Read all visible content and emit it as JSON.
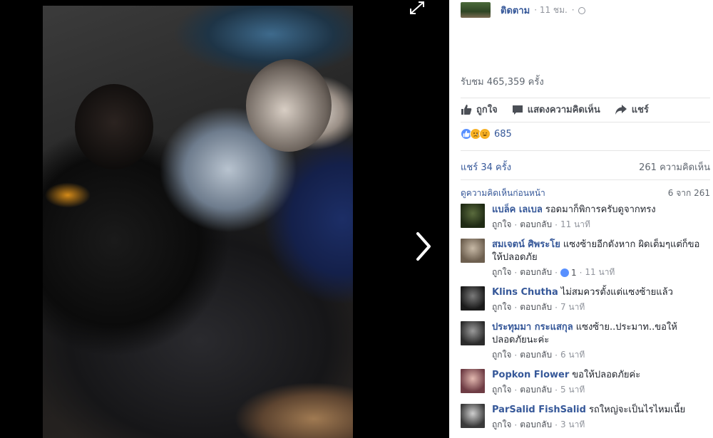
{
  "post": {
    "follow_label": "ติดตาม",
    "time": "11 ชม.",
    "views": "รับชม 465,359 ครั้ง",
    "actions": {
      "like": "ถูกใจ",
      "comment": "แสดงความคิดเห็น",
      "share": "แชร์"
    },
    "reaction_count": "685",
    "shares": "แชร์ 34 ครั้ง",
    "comment_count": "261 ความคิดเห็น",
    "prev_comments": "ดูความคิดเห็นก่อนหน้า",
    "pager": "6 จาก 261"
  },
  "comments": [
    {
      "name": "แบล็ค เลเบล",
      "text": "รอดมาก็พิการครับดูจากทรง",
      "like": "ถูกใจ",
      "reply": "ตอบกลับ",
      "time": "11 นาที",
      "replies": ""
    },
    {
      "name": "สมเจตน์ ศิพระโย",
      "text": "แซงซ้ายอีกดังหาก ผิดเต็มๆแต่ก็ขอให้ปลอดภัย",
      "like": "ถูกใจ",
      "reply": "ตอบกลับ",
      "time": "11 นาที",
      "replies": "1"
    },
    {
      "name": "Klins Chutha",
      "text": "ไม่สมควรตั้งแต่แซงซ้ายแล้ว",
      "like": "ถูกใจ",
      "reply": "ตอบกลับ",
      "time": "7 นาที",
      "replies": ""
    },
    {
      "name": "ประทุมมา กระแสกุล",
      "text": "แซงซ้าย..ประมาท..ขอให้ปลอดภัยนะค่ะ",
      "like": "ถูกใจ",
      "reply": "ตอบกลับ",
      "time": "6 นาที",
      "replies": ""
    },
    {
      "name": "Popkon Flower",
      "text": "ขอให้ปลอดภัยค่ะ",
      "like": "ถูกใจ",
      "reply": "ตอบกลับ",
      "time": "5 นาที",
      "replies": ""
    },
    {
      "name": "ParSalid FishSalid",
      "text": "รถใหญ่จะเป็นไรไหมเนี้ย",
      "like": "ถูกใจ",
      "reply": "ตอบกลับ",
      "time": "3 นาที",
      "replies": ""
    }
  ],
  "colors": {
    "link": "#365899",
    "muted": "#90949c",
    "text": "#1d2129",
    "like_blue": "#5890ff"
  },
  "icons": [
    "expand-icon",
    "next-arrow-icon",
    "globe-icon",
    "thumbs-up-icon",
    "comment-icon",
    "share-arrow-icon",
    "like-reaction-icon",
    "sad-reaction-icon",
    "haha-reaction-icon"
  ]
}
